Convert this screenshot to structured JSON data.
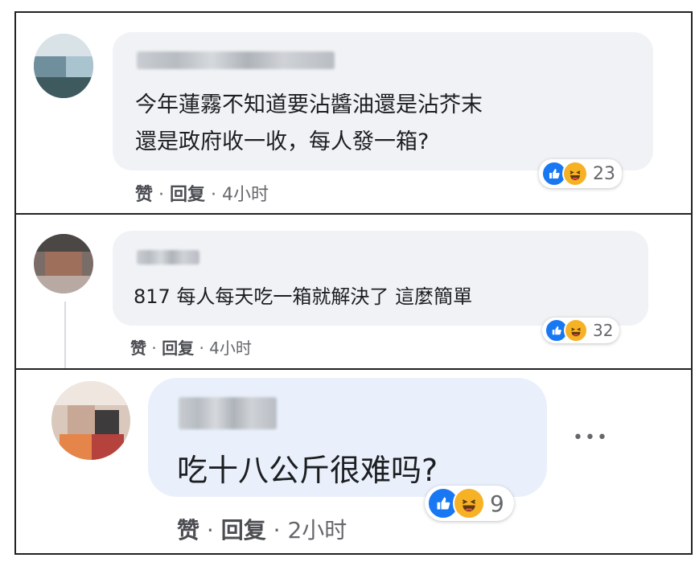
{
  "comments": [
    {
      "text_lines": [
        "今年蓮霧不知道要沾醬油還是沾芥末",
        "還是政府收一收，每人發一箱?"
      ],
      "actions": {
        "like": "赞",
        "reply": "回复",
        "sep": "·",
        "time": "4小时"
      },
      "reactions": {
        "icons": [
          "like-icon",
          "haha-icon"
        ],
        "count": "23"
      }
    },
    {
      "text_lines": [
        "817 每人每天吃一箱就解決了 這麼簡單"
      ],
      "actions": {
        "like": "赞",
        "reply": "回复",
        "sep": "·",
        "time": "4小时"
      },
      "reactions": {
        "icons": [
          "like-icon",
          "haha-icon"
        ],
        "count": "32"
      }
    },
    {
      "text_lines": [
        "吃十八公斤很难吗?"
      ],
      "actions": {
        "like": "赞",
        "reply": "回复",
        "sep": "·",
        "time": "2小时"
      },
      "reactions": {
        "icons": [
          "like-icon",
          "haha-icon"
        ],
        "count": "9"
      },
      "more": "•••"
    }
  ],
  "colors": {
    "like": "#1877f2",
    "haha": "#f7b125",
    "bubble": "#f0f2f5",
    "bubble_highlight": "#e9f0fb"
  }
}
